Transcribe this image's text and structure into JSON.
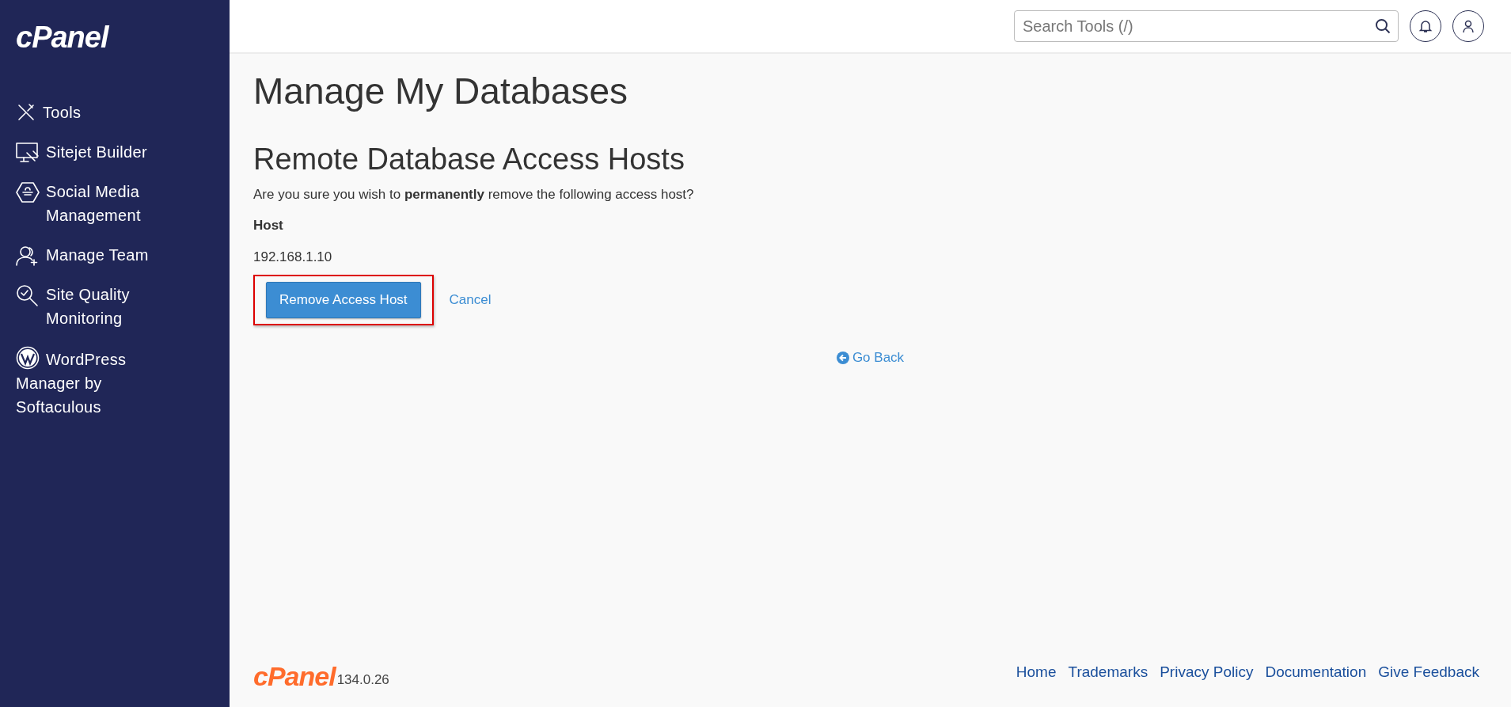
{
  "sidebar": {
    "logo": "cPanel",
    "items": [
      {
        "kind": "tools",
        "label": "Tools"
      },
      {
        "kind": "sitejet",
        "label": "Sitejet Builder"
      },
      {
        "kind": "social",
        "label": "Social Media Management"
      },
      {
        "kind": "team",
        "label": "Manage Team"
      },
      {
        "kind": "quality",
        "label": "Site Quality Monitoring"
      },
      {
        "kind": "wordpress",
        "label": "WordPress Manager by Softaculous"
      }
    ]
  },
  "header": {
    "search": {
      "placeholder": "Search Tools (/)"
    }
  },
  "page": {
    "title": "Manage My Databases",
    "section_title": "Remote Database Access Hosts",
    "question": "Are you sure you wish to **permanently** remove the following access host?",
    "host_label": "Host",
    "host_value": "192.168.1.10",
    "remove_button": {
      "label": "Remove Access Host",
      "highlighted": true
    },
    "cancel_link": "Cancel",
    "go_back_link": "Go Back"
  },
  "footer": {
    "logo": "cPanel",
    "version": "134.0.26",
    "links": [
      "Home",
      "Trademarks",
      "Privacy Policy",
      "Documentation",
      "Give Feedback"
    ]
  }
}
